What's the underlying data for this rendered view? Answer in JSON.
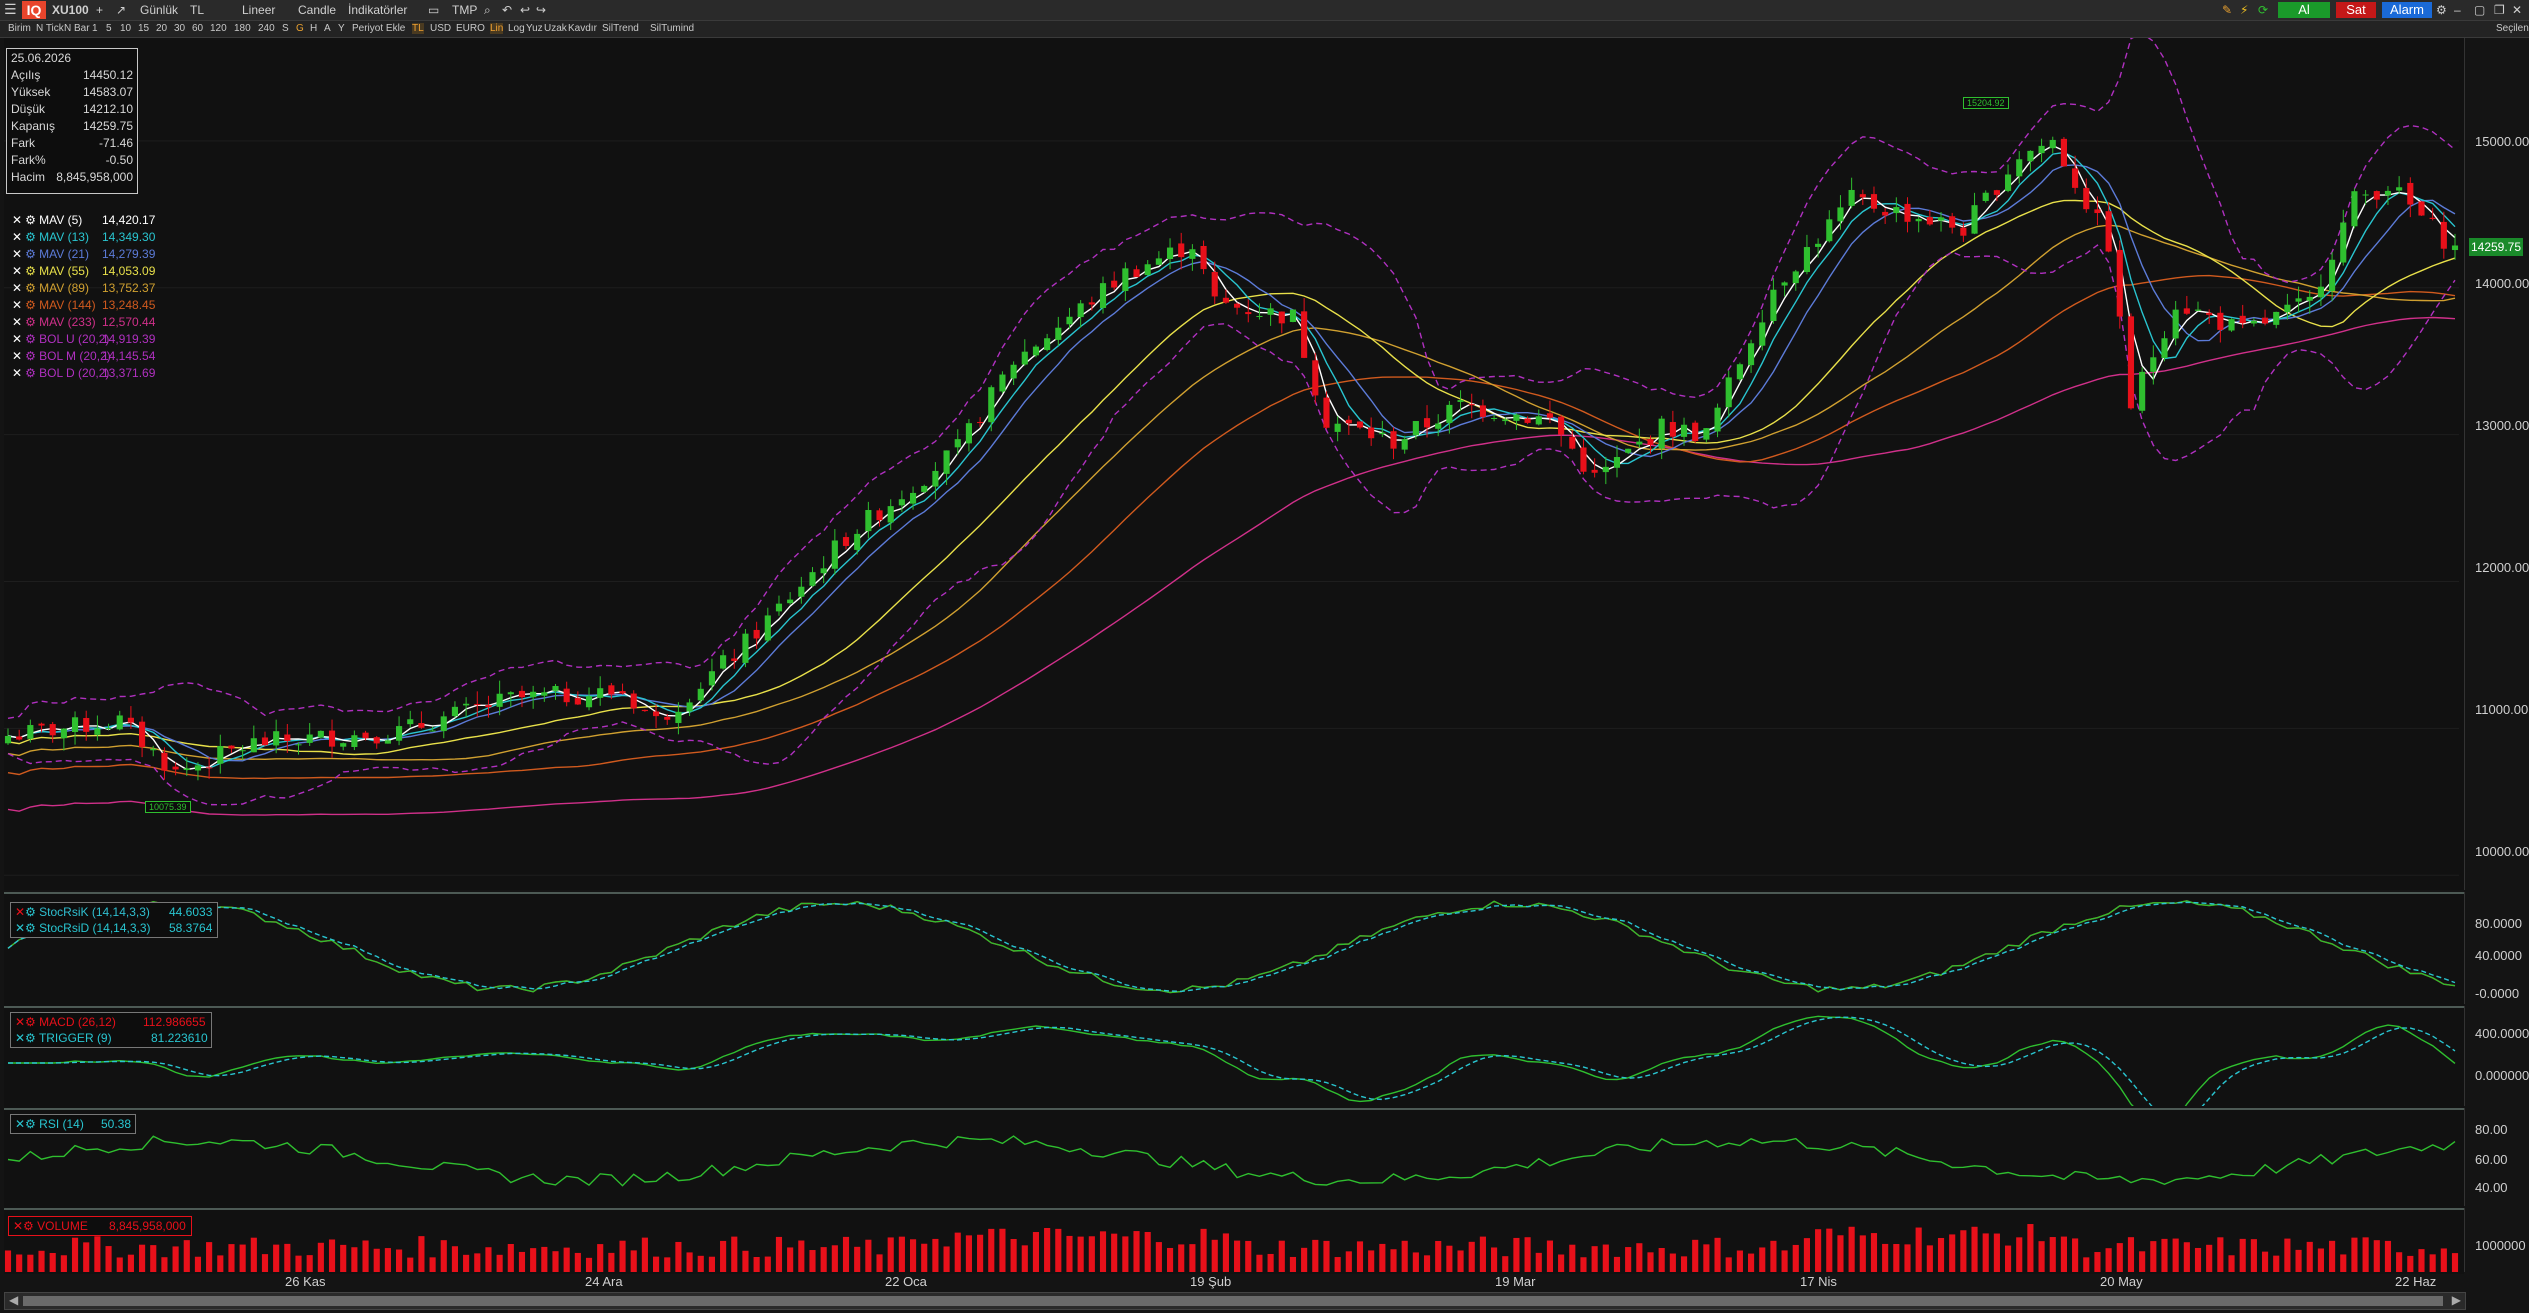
{
  "toolbar": {
    "symbol": "XU100",
    "logo": "IQ",
    "period": "Günlük",
    "currency": "TL",
    "scale": "Lineer",
    "chart_style": "Candle",
    "indicators": "İndikatörler",
    "template": "TMP",
    "buy_label": "Al",
    "sell_label": "Sat",
    "alarm_label": "Alarm"
  },
  "toolbar2": {
    "items": [
      "Birim",
      "N Tick",
      "N Bar",
      "1",
      "5",
      "10",
      "15",
      "20",
      "30",
      "60",
      "120",
      "180",
      "240",
      "S",
      "G",
      "H",
      "A",
      "Y",
      "Periyot Ekle",
      "TL",
      "USD",
      "EURO",
      "Lin",
      "Log",
      "Yuz",
      "Uzak",
      "Kavdır",
      "SilTrend",
      "SilTumind"
    ]
  },
  "side_label": "Seçilen",
  "info": {
    "date": "25.06.2026",
    "rows": [
      {
        "k": "Açılış",
        "v": "14450.12"
      },
      {
        "k": "Yüksek",
        "v": "14583.07"
      },
      {
        "k": "Düşük",
        "v": "14212.10"
      },
      {
        "k": "Kapanış",
        "v": "14259.75"
      },
      {
        "k": "Fark",
        "v": "-71.46"
      },
      {
        "k": "Fark%",
        "v": "-0.50"
      },
      {
        "k": "Hacim",
        "v": "8,845,958,000"
      }
    ]
  },
  "legend": [
    {
      "name": "MAV (5)",
      "value": "14,420.17",
      "color": "#ffffff"
    },
    {
      "name": "MAV (13)",
      "value": "14,349.30",
      "color": "#29c5d0"
    },
    {
      "name": "MAV (21)",
      "value": "14,279.39",
      "color": "#5c7bd8"
    },
    {
      "name": "MAV (55)",
      "value": "14,053.09",
      "color": "#e8e04a"
    },
    {
      "name": "MAV (89)",
      "value": "13,752.37",
      "color": "#d0a030"
    },
    {
      "name": "MAV (144)",
      "value": "13,248.45",
      "color": "#d05a1e"
    },
    {
      "name": "MAV (233)",
      "value": "12,570.44",
      "color": "#d0308a"
    },
    {
      "name": "BOL U (20,2)",
      "value": "14,919.39",
      "color": "#b030c0"
    },
    {
      "name": "BOL M (20,2)",
      "value": "14,145.54",
      "color": "#b030c0"
    },
    {
      "name": "BOL D (20,2)",
      "value": "13,371.69",
      "color": "#b030c0"
    }
  ],
  "price_axis": {
    "labels": [
      "15000.00",
      "14000.00",
      "13000.00",
      "12000.00",
      "11000.00",
      "10000.00"
    ],
    "last_price": "14259.75"
  },
  "annotations": {
    "high": "15204.92",
    "low": "10075.39"
  },
  "stoch": {
    "k_label": "StocRsiK (14,14,3,3)",
    "k_value": "44.6033",
    "d_label": "StocRsiD (14,14,3,3)",
    "d_value": "58.3764",
    "axis": [
      "80.0000",
      "40.0000",
      "-0.0000"
    ]
  },
  "macd": {
    "macd_label": "MACD (26,12)",
    "macd_value": "112.986655",
    "trig_label": "TRIGGER (9)",
    "trig_value": "81.223610",
    "axis": [
      "400.0000",
      "0.000000"
    ]
  },
  "rsi": {
    "label": "RSI (14)",
    "value": "50.38",
    "axis": [
      "80.00",
      "60.00",
      "40.00"
    ]
  },
  "volume": {
    "label": "VOLUME",
    "value": "8,845,958,000",
    "axis": [
      "1000000"
    ]
  },
  "dates": [
    "26 Kas",
    "24 Ara",
    "22 Oca",
    "19 Şub",
    "19 Mar",
    "17 Nis",
    "20 May",
    "22 Haz"
  ],
  "colors": {
    "up": "#2fbf2f",
    "down": "#e8101a",
    "bg": "#111111"
  }
}
